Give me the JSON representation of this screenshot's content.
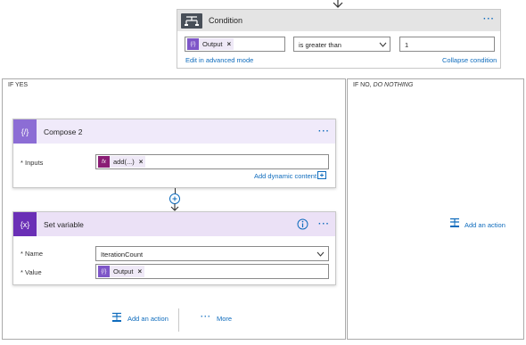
{
  "condition": {
    "title": "Condition",
    "left_token": "Output",
    "token_remove": "×",
    "operator": "is greater than",
    "right_value": "1",
    "edit_advanced": "Edit in advanced mode",
    "collapse": "Collapse condition",
    "more": "···"
  },
  "if_yes": {
    "label": "IF YES",
    "compose": {
      "title": "Compose 2",
      "more": "···",
      "inputs_label": "* Inputs",
      "inputs_token": "add(...)",
      "token_remove": "×",
      "add_dynamic": "Add dynamic content"
    },
    "set_variable": {
      "title": "Set variable",
      "more": "···",
      "info": "i",
      "name_label": "* Name",
      "name_value": "IterationCount",
      "value_label": "* Value",
      "value_token": "Output",
      "token_remove": "×"
    },
    "add_action": "Add an action",
    "more_link": "More",
    "more_dots": "···"
  },
  "if_no": {
    "label_prefix": "IF NO, ",
    "label_italic": "DO NOTHING",
    "add_action": "Add an action"
  },
  "colors": {
    "accent": "#0f6cbd",
    "compose_icon": "#8c6dd5",
    "variable_icon": "#6a2fb6",
    "condition_header": "#e4e4e4",
    "condition_icon": "#484f58"
  }
}
